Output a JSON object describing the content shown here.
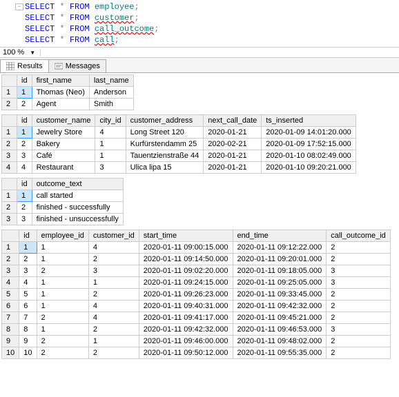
{
  "editor": {
    "lines": [
      {
        "fold": "−",
        "keyword": "SELECT",
        "star": "*",
        "from": "FROM",
        "table": "employee",
        "squiggle": false,
        "semi": ";"
      },
      {
        "fold": "",
        "keyword": "SELECT",
        "star": "*",
        "from": "FROM",
        "table": "customer",
        "squiggle": true,
        "semi": ";"
      },
      {
        "fold": "",
        "keyword": "SELECT",
        "star": "*",
        "from": "FROM",
        "table": "call_outcome",
        "squiggle": true,
        "semi": ";"
      },
      {
        "fold": "",
        "keyword": "SELECT",
        "star": "*",
        "from": "FROM",
        "table": "call",
        "squiggle": true,
        "semi": ";"
      }
    ]
  },
  "zoom": {
    "value": "100 %"
  },
  "tabs": {
    "results_label": "Results",
    "messages_label": "Messages"
  },
  "chart_data": [
    {
      "type": "table",
      "title": "employee",
      "columns": [
        "id",
        "first_name",
        "last_name"
      ],
      "rows": [
        [
          "1",
          "Thomas (Neo)",
          "Anderson"
        ],
        [
          "2",
          "Agent",
          "Smith"
        ]
      ]
    },
    {
      "type": "table",
      "title": "customer",
      "columns": [
        "id",
        "customer_name",
        "city_id",
        "customer_address",
        "next_call_date",
        "ts_inserted"
      ],
      "rows": [
        [
          "1",
          "Jewelry Store",
          "4",
          "Long Street 120",
          "2020-01-21",
          "2020-01-09 14:01:20.000"
        ],
        [
          "2",
          "Bakery",
          "1",
          "Kurfürstendamm 25",
          "2020-02-21",
          "2020-01-09 17:52:15.000"
        ],
        [
          "3",
          "Café",
          "1",
          "Tauentzienstraße 44",
          "2020-01-21",
          "2020-01-10 08:02:49.000"
        ],
        [
          "4",
          "Restaurant",
          "3",
          "Ulica lipa 15",
          "2020-01-21",
          "2020-01-10 09:20:21.000"
        ]
      ]
    },
    {
      "type": "table",
      "title": "call_outcome",
      "columns": [
        "id",
        "outcome_text"
      ],
      "rows": [
        [
          "1",
          "call started"
        ],
        [
          "2",
          "finished - successfully"
        ],
        [
          "3",
          "finished - unsuccessfully"
        ]
      ]
    },
    {
      "type": "table",
      "title": "call",
      "columns": [
        "id",
        "employee_id",
        "customer_id",
        "start_time",
        "end_time",
        "call_outcome_id"
      ],
      "rows": [
        [
          "1",
          "1",
          "4",
          "2020-01-11 09:00:15.000",
          "2020-01-11 09:12:22.000",
          "2"
        ],
        [
          "2",
          "1",
          "2",
          "2020-01-11 09:14:50.000",
          "2020-01-11 09:20:01.000",
          "2"
        ],
        [
          "3",
          "2",
          "3",
          "2020-01-11 09:02:20.000",
          "2020-01-11 09:18:05.000",
          "3"
        ],
        [
          "4",
          "1",
          "1",
          "2020-01-11 09:24:15.000",
          "2020-01-11 09:25:05.000",
          "3"
        ],
        [
          "5",
          "1",
          "2",
          "2020-01-11 09:26:23.000",
          "2020-01-11 09:33:45.000",
          "2"
        ],
        [
          "6",
          "1",
          "4",
          "2020-01-11 09:40:31.000",
          "2020-01-11 09:42:32.000",
          "2"
        ],
        [
          "7",
          "2",
          "4",
          "2020-01-11 09:41:17.000",
          "2020-01-11 09:45:21.000",
          "2"
        ],
        [
          "8",
          "1",
          "2",
          "2020-01-11 09:42:32.000",
          "2020-01-11 09:46:53.000",
          "3"
        ],
        [
          "9",
          "2",
          "1",
          "2020-01-11 09:46:00.000",
          "2020-01-11 09:48:02.000",
          "2"
        ],
        [
          "10",
          "2",
          "2",
          "2020-01-11 09:50:12.000",
          "2020-01-11 09:55:35.000",
          "2"
        ]
      ]
    }
  ]
}
